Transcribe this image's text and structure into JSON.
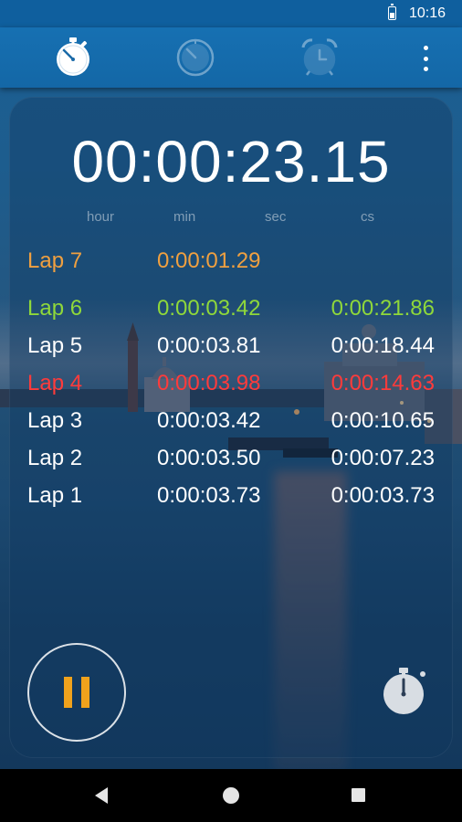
{
  "status_bar": {
    "time": "10:16"
  },
  "toolbar": {
    "tabs": [
      {
        "icon": "stopwatch-icon",
        "active": true
      },
      {
        "icon": "timer-icon",
        "active": false
      },
      {
        "icon": "alarm-clock-icon",
        "active": false
      }
    ],
    "overflow_icon": "more-vert-icon"
  },
  "timer": {
    "display": "00:00:23.15",
    "units": {
      "hour": "hour",
      "min": "min",
      "sec": "sec",
      "cs": "cs"
    }
  },
  "laps": [
    {
      "label": "Lap  7",
      "split": "0:00:01.29",
      "total": "",
      "color": "#f0a040"
    },
    {
      "label": "Lap  6",
      "split": "0:00:03.42",
      "total": "0:00:21.86",
      "color": "#8fd83a"
    },
    {
      "label": "Lap  5",
      "split": "0:00:03.81",
      "total": "0:00:18.44",
      "color": "#ffffff"
    },
    {
      "label": "Lap  4",
      "split": "0:00:03.98",
      "total": "0:00:14.63",
      "color": "#ff3b3b"
    },
    {
      "label": "Lap  3",
      "split": "0:00:03.42",
      "total": "0:00:10.65",
      "color": "#ffffff"
    },
    {
      "label": "Lap  2",
      "split": "0:00:03.50",
      "total": "0:00:07.23",
      "color": "#ffffff"
    },
    {
      "label": "Lap  1",
      "split": "0:00:03.73",
      "total": "0:00:03.73",
      "color": "#ffffff"
    }
  ],
  "controls": {
    "pause_icon": "pause-icon",
    "pause_color": "#f0a21c",
    "lap_icon": "stopwatch-lap-icon"
  },
  "nav_bar": {
    "back_icon": "back-icon",
    "home_icon": "home-icon",
    "recents_icon": "recents-icon"
  }
}
